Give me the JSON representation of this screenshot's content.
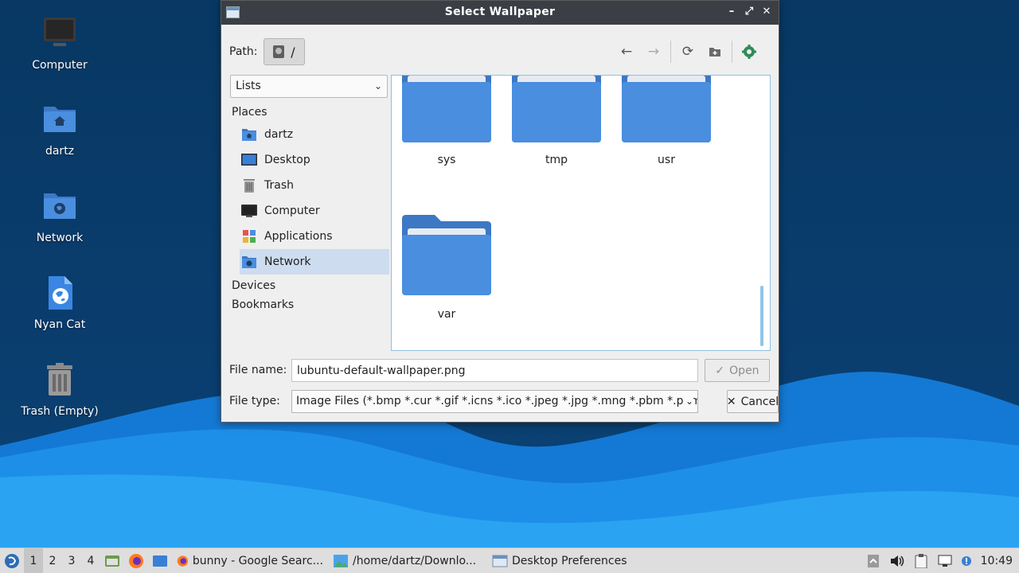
{
  "desktop": {
    "icons": [
      {
        "label": "Computer",
        "icon": "computer-icon"
      },
      {
        "label": "dartz",
        "icon": "home-folder-icon"
      },
      {
        "label": "Network",
        "icon": "network-folder-icon"
      },
      {
        "label": "Nyan Cat",
        "icon": "web-file-icon"
      },
      {
        "label": "Trash (Empty)",
        "icon": "trash-icon"
      }
    ]
  },
  "dialog": {
    "title": "Select Wallpaper",
    "titlebar_buttons": {
      "minimize": "–",
      "maximize": "⤢",
      "close": "✕"
    },
    "path_label": "Path:",
    "path_root": "/",
    "view_mode": "Lists",
    "sidebar": {
      "places_header": "Places",
      "places": [
        {
          "label": "dartz",
          "icon": "home-folder-icon"
        },
        {
          "label": "Desktop",
          "icon": "desktop-icon"
        },
        {
          "label": "Trash",
          "icon": "trash-icon"
        },
        {
          "label": "Computer",
          "icon": "computer-icon"
        },
        {
          "label": "Applications",
          "icon": "applications-icon"
        },
        {
          "label": "Network",
          "icon": "network-folder-icon",
          "selected": true
        }
      ],
      "devices_header": "Devices",
      "bookmarks_header": "Bookmarks"
    },
    "files": [
      {
        "name": "sys"
      },
      {
        "name": "tmp"
      },
      {
        "name": "usr"
      },
      {
        "name": "var"
      }
    ],
    "file_name_label": "File name:",
    "file_name_value": "lubuntu-default-wallpaper.png",
    "file_type_label": "File type:",
    "file_type_value": "Image Files (*.bmp *.cur *.gif *.icns *.ico *.jpeg *.jpg *.mng *.pbm *.pgm",
    "open_label": "Open",
    "cancel_label": "Cancel"
  },
  "taskbar": {
    "workspaces": [
      "1",
      "2",
      "3",
      "4"
    ],
    "active_workspace": "1",
    "tasks": [
      {
        "label": "bunny - Google Searc...",
        "icon": "firefox-icon"
      },
      {
        "label": "/home/dartz/Downlo...",
        "icon": "image-viewer-icon"
      },
      {
        "label": "Desktop Preferences",
        "icon": "window-icon"
      }
    ],
    "clock": "10:49"
  },
  "colors": {
    "folder": "#4a8ee0",
    "folder_tab": "#3c78c4",
    "selection": "#cddcee",
    "titlebar": "#3b3f45"
  }
}
